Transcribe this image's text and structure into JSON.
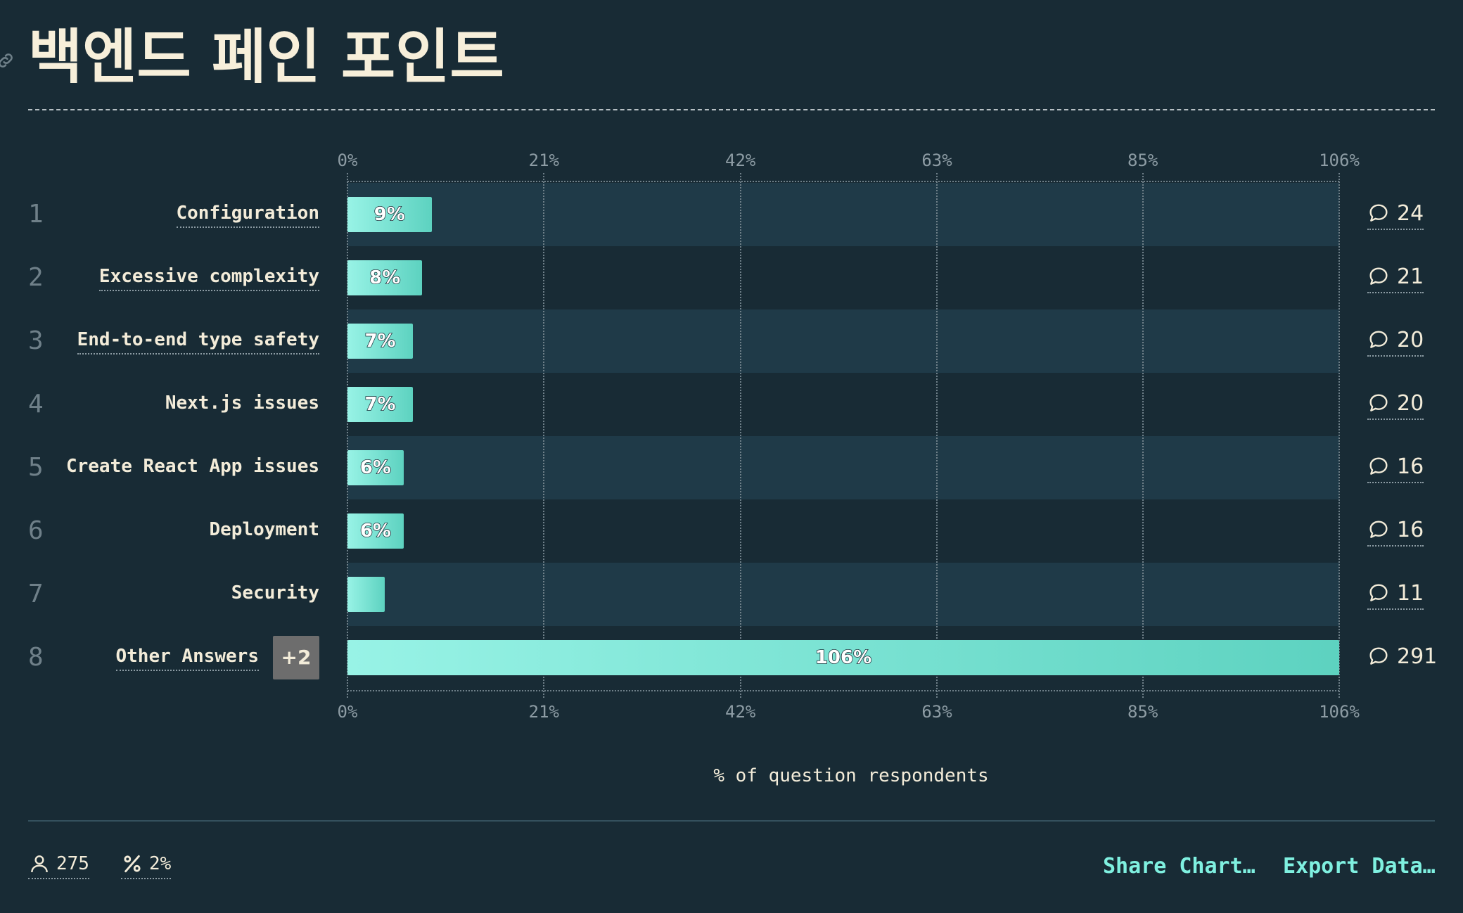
{
  "title": "백엔드 페인 포인트",
  "chart_data": {
    "type": "bar",
    "orientation": "horizontal",
    "categories": [
      "Configuration",
      "Excessive complexity",
      "End-to-end type safety",
      "Next.js issues",
      "Create React App issues",
      "Deployment",
      "Security",
      "Other Answers"
    ],
    "ranks": [
      "1",
      "2",
      "3",
      "4",
      "5",
      "6",
      "7",
      "8"
    ],
    "values": [
      9,
      8,
      7,
      7,
      6,
      6,
      4,
      106
    ],
    "value_labels": [
      "9%",
      "8%",
      "7%",
      "7%",
      "6%",
      "6%",
      "",
      "106%"
    ],
    "counts": [
      "24",
      "21",
      "20",
      "20",
      "16",
      "16",
      "11",
      "291"
    ],
    "other_badge": "+2",
    "xlim": [
      0,
      106
    ],
    "x_ticks": [
      "0%",
      "21%",
      "42%",
      "63%",
      "85%",
      "106%"
    ],
    "x_tick_values": [
      0,
      21,
      42,
      63,
      85,
      106
    ],
    "xlabel": "% of question respondents",
    "grid": true
  },
  "footer": {
    "respondents": "275",
    "percent": "2%",
    "share_label": "Share Chart…",
    "export_label": "Export Data…"
  },
  "colors": {
    "background": "#182b35",
    "band": "#1f3a48",
    "bar_start": "#98f3e6",
    "bar_end": "#5dd2c0",
    "accent": "#7ff0e0"
  },
  "icons": {
    "anchor": "link-icon",
    "count": "comment-icon",
    "respondents": "user-icon",
    "percent": "percent-icon"
  }
}
